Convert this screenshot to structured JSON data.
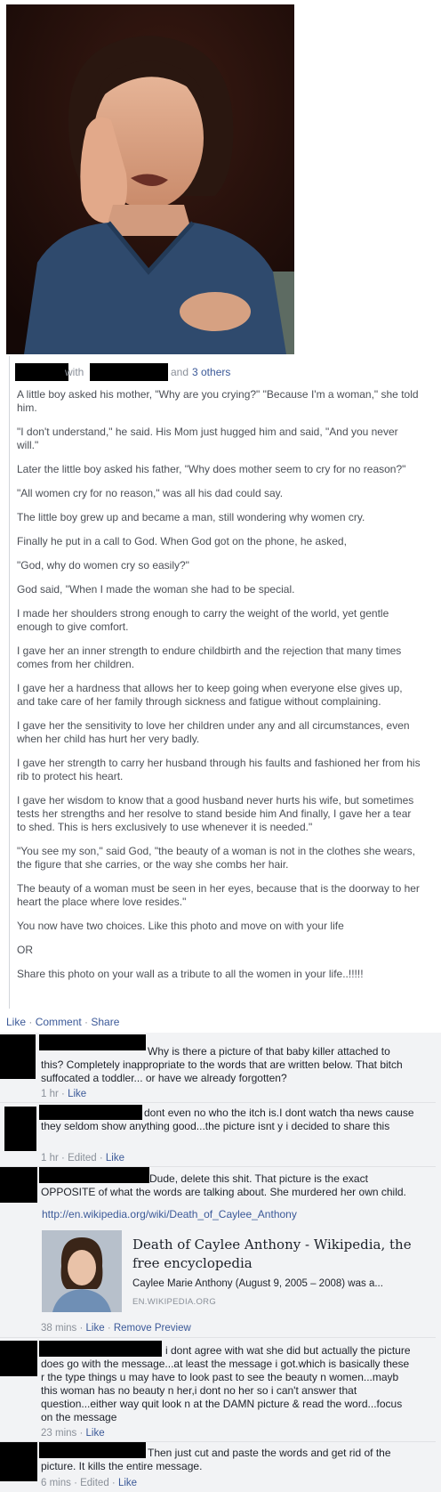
{
  "post": {
    "byline": {
      "with": "with",
      "and": "and",
      "others": "3 others"
    },
    "paragraphs": [
      "A little boy asked his mother, \"Why are you crying?\" \"Because I'm a woman,\" she told him.",
      "\"I don't understand,\" he said. His Mom just hugged him and said, \"And you never will.\"",
      "Later the little boy asked his father, \"Why does mother seem to cry for no reason?\"",
      "\"All women cry for no reason,\" was all his dad could say.",
      "The little boy grew up and became a man, still wondering why women cry.",
      "Finally he put in a call to God. When God got on the phone, he asked,",
      "\"God, why do women cry so easily?\"",
      "God said, \"When I made the woman she had to be special.",
      "I made her shoulders strong enough to carry the weight of the world, yet gentle enough to give comfort.",
      "I gave her an inner strength to endure childbirth and the rejection that many times comes from her children.",
      "I gave her a hardness that allows her to keep going when everyone else gives up, and take care of her family through sickness and fatigue without complaining.",
      "I gave her the sensitivity to love her children under any and all circumstances, even when her child has hurt her very badly.",
      "I gave her strength to carry her husband through his faults and fashioned her from his rib to protect his heart.",
      "I gave her wisdom to know that a good husband never hurts his wife, but sometimes tests her strengths and her resolve to stand beside him And finally, I gave her a tear to shed. This is hers exclusively to use whenever it is needed.\"",
      "\"You see my son,\" said God, \"the beauty of a woman is not in the clothes she wears, the figure that she carries, or the way she combs her hair.",
      "The beauty of a woman must be seen in her eyes, because that is the doorway to her heart the place where love resides.\"",
      "You now have two choices. Like this photo and move on with your life",
      "OR",
      "Share this photo on your wall as a tribute to all the women in your life..!!!!!"
    ],
    "actions": {
      "like": "Like",
      "comment": "Comment",
      "share": "Share",
      "sep": " · "
    }
  },
  "comments": [
    {
      "text": "Why is there a picture of that baby killer attached to this? Completely inappropriate to the words that are written below. That bitch suffocated a toddler... or have we already forgotten?",
      "time": "1 hr",
      "like": "Like"
    },
    {
      "text": "dont even no who the itch is.I dont watch tha news cause they seldom show anything good...the picture isnt y i decided to share this",
      "time": "1 hr",
      "edited": "Edited",
      "like": "Like"
    },
    {
      "text": "Dude, delete this shit. That picture is the exact OPPOSITE of what the words are talking about. She murdered her own child.",
      "link": "http://en.wikipedia.org/wiki/Death_of_Caylee_Anthony",
      "preview": {
        "title": "Death of Caylee Anthony - Wikipedia, the free encyclopedia",
        "desc": "Caylee Marie Anthony (August 9, 2005 – 2008) was a...",
        "domain": "EN.WIKIPEDIA.ORG"
      },
      "time": "38 mins",
      "like": "Like",
      "remove": "Remove Preview"
    },
    {
      "text": "i dont agree with wat she did but actually the picture does go with the message...at least the message i got.which is basically these r the type things u may have to look past to see the beauty n women...mayb this woman has no beauty n her,i dont no her so i can't answer that question...either way quit look n at the DAMN picture & read the word...focus on the message",
      "time": "23 mins",
      "like": "Like"
    },
    {
      "text": "Then just cut and paste the words and get rid of the picture. It kills the entire message.",
      "time": "6 mins",
      "edited": "Edited",
      "like": "Like"
    }
  ],
  "colors": {
    "link": "#3b5998",
    "meta": "#8a9099",
    "comment_bg": "#f2f3f5"
  }
}
